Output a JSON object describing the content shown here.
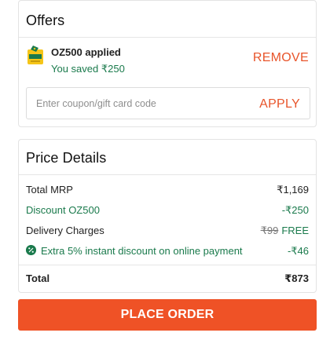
{
  "offers": {
    "title": "Offers",
    "applied_code": "OZ500 applied",
    "saved_text": "You saved ₹250",
    "remove_label": "REMOVE",
    "input_placeholder": "Enter coupon/gift card code",
    "input_value": "",
    "apply_label": "APPLY"
  },
  "price_details": {
    "title": "Price Details",
    "total_mrp_label": "Total MRP",
    "total_mrp_value": "₹1,169",
    "discount_label": "Discount OZ500",
    "discount_value": "-₹250",
    "delivery_label": "Delivery Charges",
    "delivery_original": "₹99",
    "delivery_value": "FREE",
    "extra_label": "Extra 5% instant discount on online payment",
    "extra_value": "-₹46",
    "total_label": "Total",
    "total_value": "₹873"
  },
  "place_order_label": "PLACE ORDER",
  "colors": {
    "accent": "#ef5226",
    "green": "#1a7a4c"
  },
  "icons": {
    "coupon": "coupon-tag-icon",
    "extra_discount": "discount-badge-icon"
  }
}
